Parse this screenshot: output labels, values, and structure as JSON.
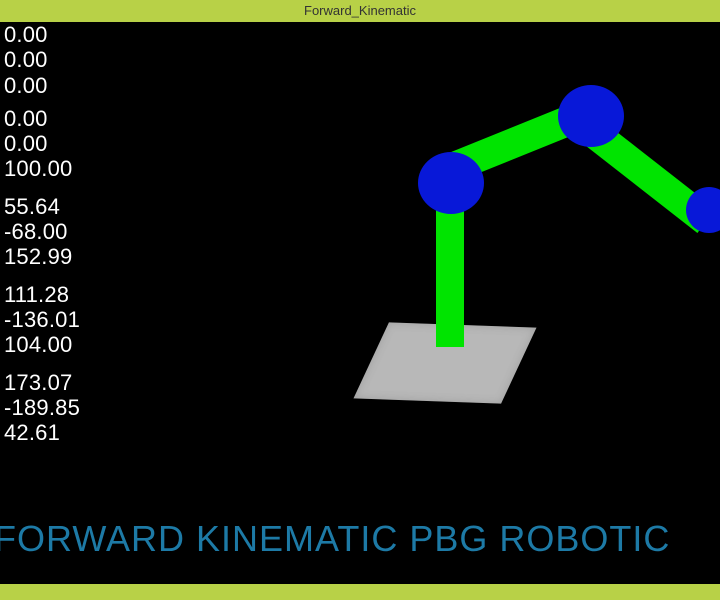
{
  "window": {
    "title": "Forward_Kinematic"
  },
  "readout": {
    "group1": [
      "0.00",
      "0.00",
      "0.00"
    ],
    "group2": [
      "0.00",
      "0.00",
      "100.00"
    ],
    "group3": [
      "55.64",
      "-68.00",
      "152.99"
    ],
    "group4": [
      "111.28",
      "-136.01",
      "104.00"
    ],
    "group5": [
      "173.07",
      "-189.85",
      "42.61"
    ]
  },
  "banner": {
    "text": "FORWARD KINEMATIC PBG ROBOTIC"
  },
  "robot": {
    "base_color": "#b8b8b8",
    "link_color": "#00e400",
    "joint_color": "#0818d8",
    "joints": [
      "shoulder",
      "elbow",
      "wrist"
    ]
  }
}
